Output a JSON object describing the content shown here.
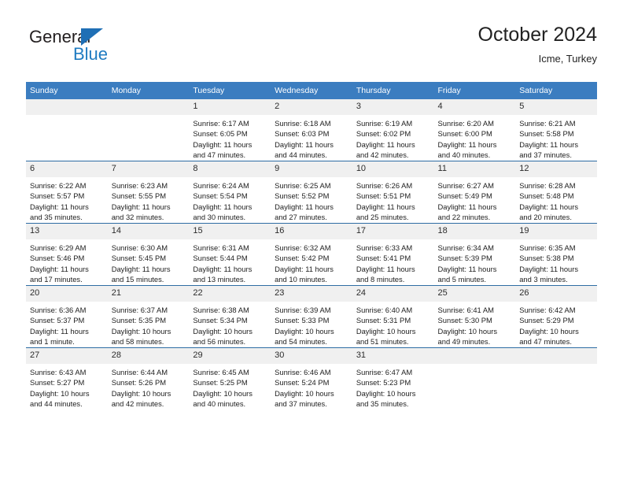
{
  "brand": {
    "name_part1": "General",
    "name_part2": "Blue"
  },
  "header": {
    "title": "October 2024",
    "subtitle": "Icme, Turkey"
  },
  "colors": {
    "header_blue": "#3b7dc0",
    "row_divider_blue": "#2e6da4",
    "daynum_band": "#f0f0f0",
    "brand_blue": "#1f7bc1"
  },
  "weekdays": [
    "Sunday",
    "Monday",
    "Tuesday",
    "Wednesday",
    "Thursday",
    "Friday",
    "Saturday"
  ],
  "weeks": [
    [
      {
        "day": "",
        "sunrise": "",
        "sunset": "",
        "daylight1": "",
        "daylight2": ""
      },
      {
        "day": "",
        "sunrise": "",
        "sunset": "",
        "daylight1": "",
        "daylight2": ""
      },
      {
        "day": "1",
        "sunrise": "Sunrise: 6:17 AM",
        "sunset": "Sunset: 6:05 PM",
        "daylight1": "Daylight: 11 hours",
        "daylight2": "and 47 minutes."
      },
      {
        "day": "2",
        "sunrise": "Sunrise: 6:18 AM",
        "sunset": "Sunset: 6:03 PM",
        "daylight1": "Daylight: 11 hours",
        "daylight2": "and 44 minutes."
      },
      {
        "day": "3",
        "sunrise": "Sunrise: 6:19 AM",
        "sunset": "Sunset: 6:02 PM",
        "daylight1": "Daylight: 11 hours",
        "daylight2": "and 42 minutes."
      },
      {
        "day": "4",
        "sunrise": "Sunrise: 6:20 AM",
        "sunset": "Sunset: 6:00 PM",
        "daylight1": "Daylight: 11 hours",
        "daylight2": "and 40 minutes."
      },
      {
        "day": "5",
        "sunrise": "Sunrise: 6:21 AM",
        "sunset": "Sunset: 5:58 PM",
        "daylight1": "Daylight: 11 hours",
        "daylight2": "and 37 minutes."
      }
    ],
    [
      {
        "day": "6",
        "sunrise": "Sunrise: 6:22 AM",
        "sunset": "Sunset: 5:57 PM",
        "daylight1": "Daylight: 11 hours",
        "daylight2": "and 35 minutes."
      },
      {
        "day": "7",
        "sunrise": "Sunrise: 6:23 AM",
        "sunset": "Sunset: 5:55 PM",
        "daylight1": "Daylight: 11 hours",
        "daylight2": "and 32 minutes."
      },
      {
        "day": "8",
        "sunrise": "Sunrise: 6:24 AM",
        "sunset": "Sunset: 5:54 PM",
        "daylight1": "Daylight: 11 hours",
        "daylight2": "and 30 minutes."
      },
      {
        "day": "9",
        "sunrise": "Sunrise: 6:25 AM",
        "sunset": "Sunset: 5:52 PM",
        "daylight1": "Daylight: 11 hours",
        "daylight2": "and 27 minutes."
      },
      {
        "day": "10",
        "sunrise": "Sunrise: 6:26 AM",
        "sunset": "Sunset: 5:51 PM",
        "daylight1": "Daylight: 11 hours",
        "daylight2": "and 25 minutes."
      },
      {
        "day": "11",
        "sunrise": "Sunrise: 6:27 AM",
        "sunset": "Sunset: 5:49 PM",
        "daylight1": "Daylight: 11 hours",
        "daylight2": "and 22 minutes."
      },
      {
        "day": "12",
        "sunrise": "Sunrise: 6:28 AM",
        "sunset": "Sunset: 5:48 PM",
        "daylight1": "Daylight: 11 hours",
        "daylight2": "and 20 minutes."
      }
    ],
    [
      {
        "day": "13",
        "sunrise": "Sunrise: 6:29 AM",
        "sunset": "Sunset: 5:46 PM",
        "daylight1": "Daylight: 11 hours",
        "daylight2": "and 17 minutes."
      },
      {
        "day": "14",
        "sunrise": "Sunrise: 6:30 AM",
        "sunset": "Sunset: 5:45 PM",
        "daylight1": "Daylight: 11 hours",
        "daylight2": "and 15 minutes."
      },
      {
        "day": "15",
        "sunrise": "Sunrise: 6:31 AM",
        "sunset": "Sunset: 5:44 PM",
        "daylight1": "Daylight: 11 hours",
        "daylight2": "and 13 minutes."
      },
      {
        "day": "16",
        "sunrise": "Sunrise: 6:32 AM",
        "sunset": "Sunset: 5:42 PM",
        "daylight1": "Daylight: 11 hours",
        "daylight2": "and 10 minutes."
      },
      {
        "day": "17",
        "sunrise": "Sunrise: 6:33 AM",
        "sunset": "Sunset: 5:41 PM",
        "daylight1": "Daylight: 11 hours",
        "daylight2": "and 8 minutes."
      },
      {
        "day": "18",
        "sunrise": "Sunrise: 6:34 AM",
        "sunset": "Sunset: 5:39 PM",
        "daylight1": "Daylight: 11 hours",
        "daylight2": "and 5 minutes."
      },
      {
        "day": "19",
        "sunrise": "Sunrise: 6:35 AM",
        "sunset": "Sunset: 5:38 PM",
        "daylight1": "Daylight: 11 hours",
        "daylight2": "and 3 minutes."
      }
    ],
    [
      {
        "day": "20",
        "sunrise": "Sunrise: 6:36 AM",
        "sunset": "Sunset: 5:37 PM",
        "daylight1": "Daylight: 11 hours",
        "daylight2": "and 1 minute."
      },
      {
        "day": "21",
        "sunrise": "Sunrise: 6:37 AM",
        "sunset": "Sunset: 5:35 PM",
        "daylight1": "Daylight: 10 hours",
        "daylight2": "and 58 minutes."
      },
      {
        "day": "22",
        "sunrise": "Sunrise: 6:38 AM",
        "sunset": "Sunset: 5:34 PM",
        "daylight1": "Daylight: 10 hours",
        "daylight2": "and 56 minutes."
      },
      {
        "day": "23",
        "sunrise": "Sunrise: 6:39 AM",
        "sunset": "Sunset: 5:33 PM",
        "daylight1": "Daylight: 10 hours",
        "daylight2": "and 54 minutes."
      },
      {
        "day": "24",
        "sunrise": "Sunrise: 6:40 AM",
        "sunset": "Sunset: 5:31 PM",
        "daylight1": "Daylight: 10 hours",
        "daylight2": "and 51 minutes."
      },
      {
        "day": "25",
        "sunrise": "Sunrise: 6:41 AM",
        "sunset": "Sunset: 5:30 PM",
        "daylight1": "Daylight: 10 hours",
        "daylight2": "and 49 minutes."
      },
      {
        "day": "26",
        "sunrise": "Sunrise: 6:42 AM",
        "sunset": "Sunset: 5:29 PM",
        "daylight1": "Daylight: 10 hours",
        "daylight2": "and 47 minutes."
      }
    ],
    [
      {
        "day": "27",
        "sunrise": "Sunrise: 6:43 AM",
        "sunset": "Sunset: 5:27 PM",
        "daylight1": "Daylight: 10 hours",
        "daylight2": "and 44 minutes."
      },
      {
        "day": "28",
        "sunrise": "Sunrise: 6:44 AM",
        "sunset": "Sunset: 5:26 PM",
        "daylight1": "Daylight: 10 hours",
        "daylight2": "and 42 minutes."
      },
      {
        "day": "29",
        "sunrise": "Sunrise: 6:45 AM",
        "sunset": "Sunset: 5:25 PM",
        "daylight1": "Daylight: 10 hours",
        "daylight2": "and 40 minutes."
      },
      {
        "day": "30",
        "sunrise": "Sunrise: 6:46 AM",
        "sunset": "Sunset: 5:24 PM",
        "daylight1": "Daylight: 10 hours",
        "daylight2": "and 37 minutes."
      },
      {
        "day": "31",
        "sunrise": "Sunrise: 6:47 AM",
        "sunset": "Sunset: 5:23 PM",
        "daylight1": "Daylight: 10 hours",
        "daylight2": "and 35 minutes."
      },
      {
        "day": "",
        "sunrise": "",
        "sunset": "",
        "daylight1": "",
        "daylight2": ""
      },
      {
        "day": "",
        "sunrise": "",
        "sunset": "",
        "daylight1": "",
        "daylight2": ""
      }
    ]
  ]
}
